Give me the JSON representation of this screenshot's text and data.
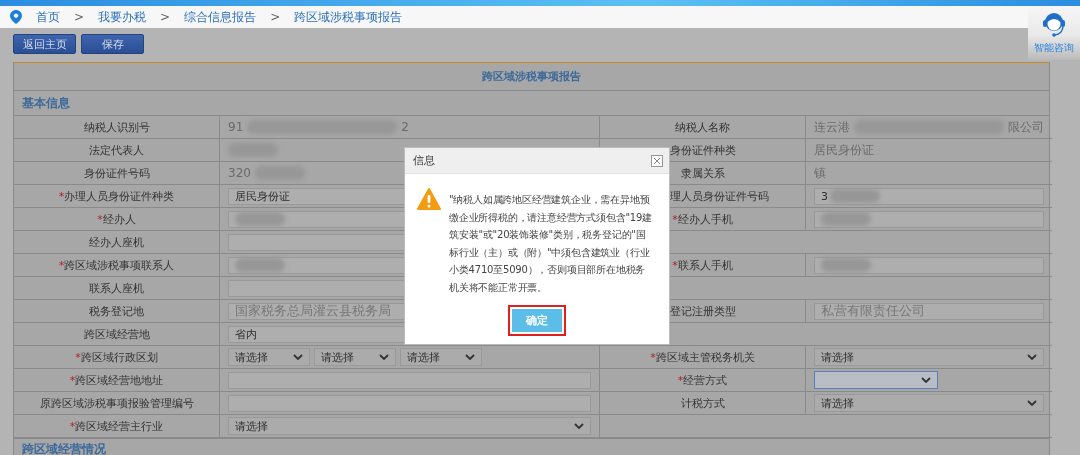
{
  "breadcrumb": [
    {
      "kind": "link",
      "text": "首页"
    },
    {
      "kind": "sep",
      "text": ">"
    },
    {
      "kind": "link",
      "text": "我要办税"
    },
    {
      "kind": "sep",
      "text": ">"
    },
    {
      "kind": "link",
      "text": "综合信息报告"
    },
    {
      "kind": "sep",
      "text": ">"
    },
    {
      "kind": "link",
      "text": "跨区域涉税事项报告"
    }
  ],
  "help_widget": {
    "label": "智能咨询"
  },
  "toolbar": {
    "buttons": [
      "返回主页",
      "保存"
    ]
  },
  "form": {
    "title": "跨区域涉税事项报告",
    "section": "基本信息",
    "rows": [
      {
        "left": {
          "label": "纳税人识别号",
          "value": {
            "kind": "text",
            "text": "91",
            "text_end": "2",
            "redacted": true
          }
        },
        "right": {
          "label": "纳税人名称",
          "value": {
            "kind": "text",
            "text": "连云港",
            "text_end": "限公司",
            "redacted": true
          }
        }
      },
      {
        "left": {
          "label": "法定代表人",
          "value": {
            "kind": "text",
            "redacted": true
          }
        },
        "right": {
          "label": "身份证件种类",
          "value": {
            "kind": "text",
            "text": "居民身份证"
          }
        }
      },
      {
        "left": {
          "label": "身份证件号码",
          "value": {
            "kind": "text",
            "text": "320",
            "redacted": true
          }
        },
        "right": {
          "label": "隶属关系",
          "value": {
            "kind": "text",
            "text": "镇"
          }
        }
      },
      {
        "left": {
          "required_mark": "*",
          "label": "办理人员身份证件种类",
          "value": {
            "kind": "input",
            "text": "居民身份证"
          }
        },
        "right": {
          "label": "理人员身份证件号码",
          "cut": true,
          "value": {
            "kind": "input",
            "text": "3",
            "redacted": true
          }
        }
      },
      {
        "left": {
          "required_mark": "*",
          "label": "经办人",
          "value": {
            "kind": "input",
            "redacted": true
          }
        },
        "right": {
          "required_mark": "*",
          "label": "经办人手机",
          "value": {
            "kind": "input",
            "redacted": true
          }
        }
      },
      {
        "left": {
          "label": "经办人座机",
          "value": {
            "kind": "input"
          }
        },
        "right": {
          "kind": "blank"
        }
      },
      {
        "left": {
          "required_mark": "*",
          "label": "跨区域涉税事项联系人",
          "value": {
            "kind": "input",
            "redacted": true
          }
        },
        "right": {
          "required_mark": "*",
          "label": "联系人手机",
          "value": {
            "kind": "input",
            "redacted": true
          }
        }
      },
      {
        "left": {
          "label": "联系人座机",
          "value": {
            "kind": "input"
          }
        },
        "right": {
          "kind": "blank"
        }
      },
      {
        "left": {
          "label": "税务登记地",
          "value": {
            "kind": "input",
            "text": "国家税务总局灌云县税务局",
            "readonly": true
          }
        },
        "right": {
          "label": "登记注册类型",
          "value": {
            "kind": "input",
            "text": "私营有限责任公司",
            "readonly": true
          }
        }
      },
      {
        "left": {
          "label": "跨区域经营地",
          "value": {
            "kind": "input",
            "text": "省内"
          }
        },
        "right": {
          "kind": "blank"
        }
      },
      {
        "left": {
          "required_mark": "*",
          "label": "跨区域行政区划",
          "value": {
            "kind": "selects",
            "options": [
              "请选择",
              "请选择",
              "请选择"
            ]
          }
        },
        "right": {
          "required_mark": "*",
          "label": "跨区域主管税务机关",
          "value": {
            "kind": "select",
            "text": "请选择"
          }
        }
      },
      {
        "left": {
          "required_mark": "*",
          "label": "跨区域经营地地址",
          "value": {
            "kind": "input"
          }
        },
        "right": {
          "required_mark": "*",
          "label": "经营方式",
          "value": {
            "kind": "select",
            "focused": true
          }
        }
      },
      {
        "left": {
          "label": "原跨区域涉税事项报验管理编号",
          "value": {
            "kind": "input"
          }
        },
        "right": {
          "label": "计税方式",
          "value": {
            "kind": "select",
            "text": "请选择"
          }
        }
      },
      {
        "left": {
          "required_mark": "*",
          "label": "跨区域经营主行业",
          "value": {
            "kind": "select",
            "text": "请选择"
          }
        },
        "right": {
          "kind": "blank"
        }
      }
    ],
    "next_section": "跨区域经营情况"
  },
  "dialog": {
    "title": "信息",
    "message": "\"纳税人如属跨地区经营建筑企业，需在异地预缴企业所得税的，请注意经营方式须包含\"19建筑安装\"或\"20装饰装修\"类别，税务登记的\"国标行业（主）或（附）\"中须包含建筑业（行业小类4710至5090），否则项目部所在地税务机关将不能正常开票。",
    "button": "确定",
    "button_highlighted": true
  }
}
